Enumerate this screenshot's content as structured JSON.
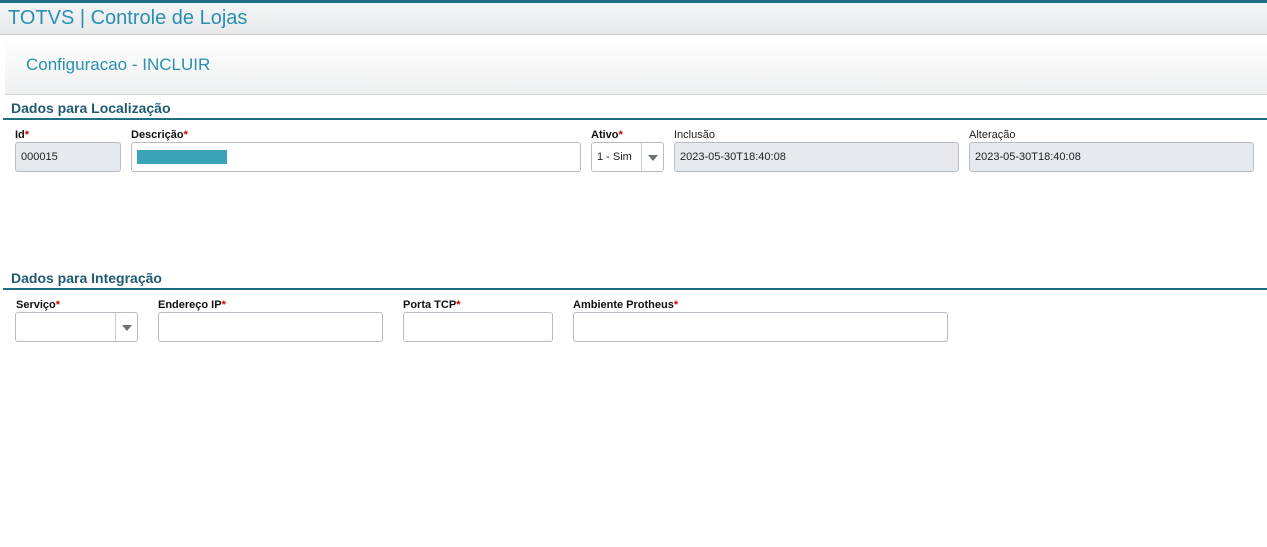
{
  "app": {
    "title": "TOTVS | Controle de Lojas"
  },
  "page": {
    "title": "Configuracao - INCLUIR"
  },
  "section_localizacao": {
    "title": "Dados para Localização",
    "id": {
      "label": "Id",
      "required_mark": "*",
      "value": "000015"
    },
    "descricao": {
      "label": "Descrição",
      "required_mark": "*",
      "value": ""
    },
    "ativo": {
      "label": "Ativo",
      "required_mark": "*",
      "value": "1 - Sim"
    },
    "inclusao": {
      "label": "Inclusão",
      "value": "2023-05-30T18:40:08"
    },
    "alteracao": {
      "label": "Alteração",
      "value": "2023-05-30T18:40:08"
    }
  },
  "section_integracao": {
    "title": "Dados para Integração",
    "servico": {
      "label": "Serviço",
      "required_mark": "*",
      "value": ""
    },
    "endereco_ip": {
      "label": "Endereço IP",
      "required_mark": "*",
      "value": ""
    },
    "porta_tcp": {
      "label": "Porta TCP",
      "required_mark": "*",
      "value": ""
    },
    "ambiente_protheus": {
      "label": "Ambiente Protheus",
      "required_mark": "*",
      "value": ""
    }
  },
  "colors": {
    "accent": "#2a8fb0",
    "section_title": "#1e5a70",
    "section_line": "#1f6e82",
    "required": "#d00000",
    "readonly_bg": "#e6e9ee",
    "selection_highlight": "#3aa3b8"
  },
  "icons": {
    "dropdown": "chevron-down-icon"
  }
}
